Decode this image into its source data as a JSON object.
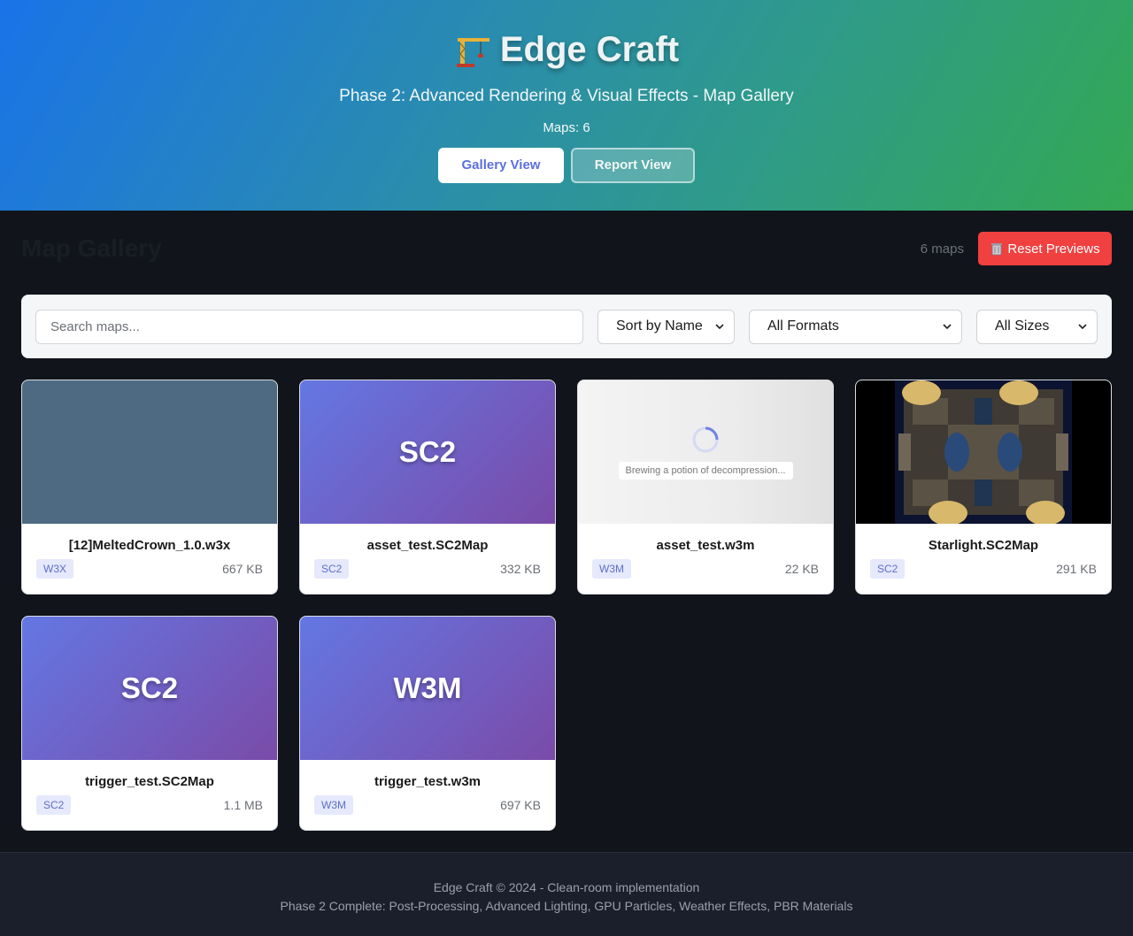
{
  "header": {
    "title": "Edge Craft",
    "subtitle": "Phase 2: Advanced Rendering & Visual Effects - Map Gallery",
    "maps_label": "Maps: 6",
    "buttons": {
      "gallery": "Gallery View",
      "report": "Report View"
    }
  },
  "gallery": {
    "title": "Map Gallery",
    "count_label": "6 maps",
    "reset_label": "Reset Previews"
  },
  "filters": {
    "search_placeholder": "Search maps...",
    "sort": "Sort by Name",
    "format": "All Formats",
    "size": "All Sizes"
  },
  "maps": [
    {
      "name": "[12]MeltedCrown_1.0.w3x",
      "format": "W3X",
      "size": "667 KB",
      "thumb": "plain"
    },
    {
      "name": "asset_test.SC2Map",
      "format": "SC2",
      "size": "332 KB",
      "thumb": "label",
      "thumb_label": "SC2"
    },
    {
      "name": "asset_test.w3m",
      "format": "W3M",
      "size": "22 KB",
      "thumb": "loading",
      "loading_text": "Brewing a potion of decompression..."
    },
    {
      "name": "Starlight.SC2Map",
      "format": "SC2",
      "size": "291 KB",
      "thumb": "map-preview"
    },
    {
      "name": "trigger_test.SC2Map",
      "format": "SC2",
      "size": "1.1 MB",
      "thumb": "label",
      "thumb_label": "SC2"
    },
    {
      "name": "trigger_test.w3m",
      "format": "W3M",
      "size": "697 KB",
      "thumb": "label",
      "thumb_label": "W3M"
    }
  ],
  "footer": {
    "line1": "Edge Craft © 2024 - Clean-room implementation",
    "line2": "Phase 2 Complete: Post-Processing, Advanced Lighting, GPU Particles, Weather Effects, PBR Materials"
  },
  "colors": {
    "accent": "#5b6fe0",
    "danger": "#f04040",
    "header_gradient_start": "#1a73e8",
    "header_gradient_end": "#34a853"
  },
  "icons": [
    "crane-icon",
    "trash-icon",
    "chevron-down-icon",
    "spinner-icon"
  ]
}
